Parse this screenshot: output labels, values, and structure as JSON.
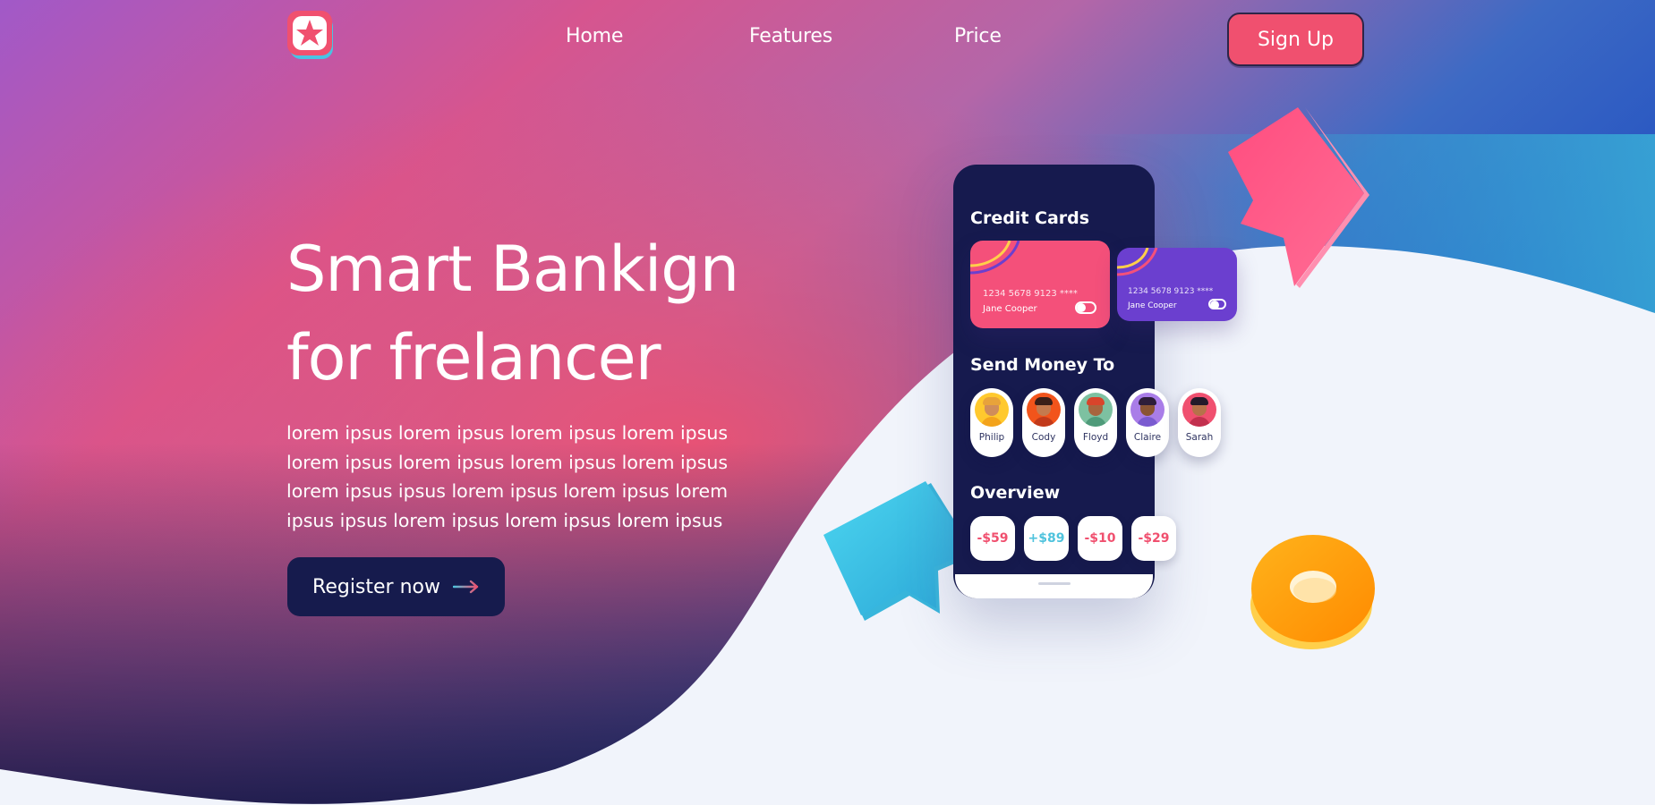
{
  "nav": {
    "links": [
      "Home",
      "Features",
      "Price"
    ],
    "signup_label": "Sign Up"
  },
  "hero": {
    "title_line1": "Smart Bankign",
    "title_line2": "for frelancer",
    "description": "lorem ipsus lorem ipsus lorem ipsus lorem ipsus lorem ipsus lorem ipsus lorem ipsus lorem ipsus lorem ipsus ipsus lorem ipsus lorem ipsus lorem ipsus ipsus lorem ipsus lorem ipsus lorem ipsus",
    "cta_label": "Register now"
  },
  "phone": {
    "credit_cards_title": "Credit Cards",
    "cards": [
      {
        "number": "1234 5678 9123 ****",
        "holder": "Jane Cooper",
        "color": "#f4507a"
      },
      {
        "number": "1234 5678 9123 ****",
        "holder": "Jane Cooper",
        "color": "#6b3fcf"
      }
    ],
    "send_money_title": "Send Money To",
    "contacts": [
      "Philip",
      "Cody",
      "Floyd",
      "Claire",
      "Sarah"
    ],
    "overview_title": "Overview",
    "amounts": [
      "-$59",
      "+$89",
      "-$10",
      "-$29"
    ]
  },
  "colors": {
    "accent": "#f0506f",
    "dark": "#161b4d",
    "positive": "#4fc3dd",
    "negative": "#f0506f"
  }
}
